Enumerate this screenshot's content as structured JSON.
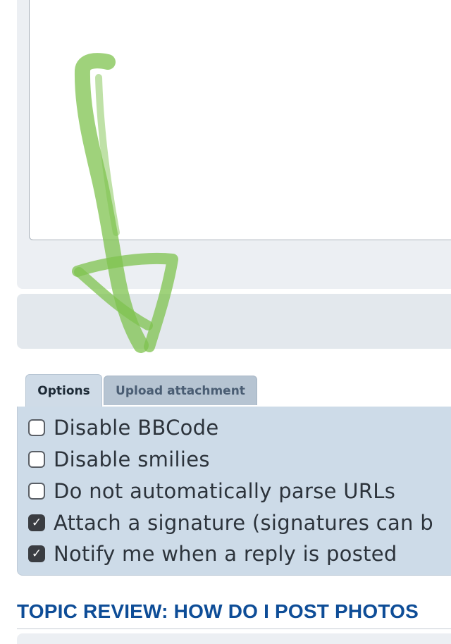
{
  "editor": {
    "message_value": ""
  },
  "tabs": [
    {
      "label": "Options",
      "active": true
    },
    {
      "label": "Upload attachment",
      "active": false
    }
  ],
  "options": [
    {
      "label": "Disable BBCode",
      "checked": false
    },
    {
      "label": "Disable smilies",
      "checked": false
    },
    {
      "label": "Do not automatically parse URLs",
      "checked": false
    },
    {
      "label": "Attach a signature (signatures can b",
      "checked": true
    },
    {
      "label": "Notify me when a reply is posted",
      "checked": true
    }
  ],
  "topic_review": {
    "heading": "TOPIC REVIEW: HOW DO I POST PHOTOS"
  },
  "colors": {
    "heading": "#0e4d97",
    "annotation_arrow": "#7fc34f",
    "options_panel": "#cddbe8"
  },
  "annotation": {
    "icon": "arrow-down-icon"
  }
}
